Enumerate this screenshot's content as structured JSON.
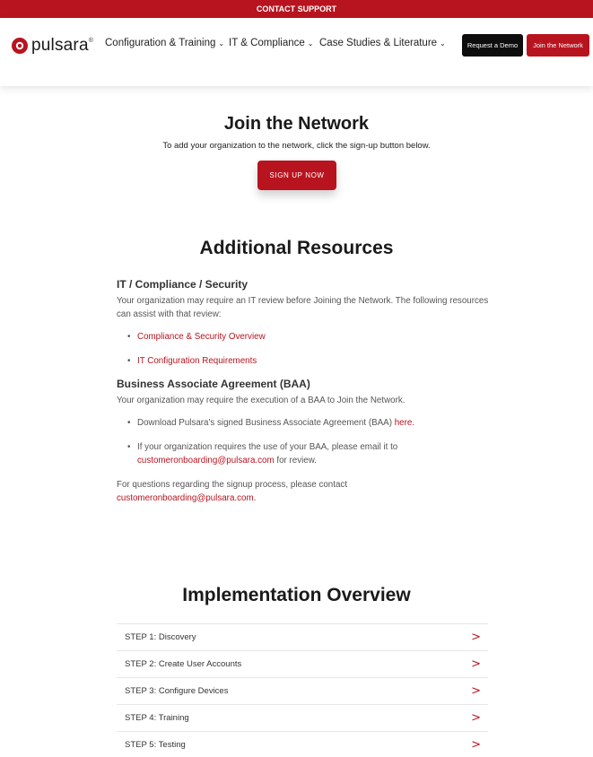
{
  "top_bar": {
    "label": "CONTACT SUPPORT"
  },
  "brand": {
    "name": "pulsara",
    "registered": "®",
    "accent_color": "#b8141f"
  },
  "nav": {
    "items": [
      {
        "label": "Configuration & Training"
      },
      {
        "label": "IT & Compliance"
      },
      {
        "label": "Case Studies & Literature"
      }
    ],
    "request_demo_label": "Request a Demo",
    "join_network_label": "Join the Network"
  },
  "join": {
    "title": "Join the Network",
    "text": "To add your organization to the network, click the sign-up button below.",
    "button_label": "SIGN UP NOW"
  },
  "resources": {
    "title": "Additional Resources",
    "it_heading": "IT / Compliance / Security",
    "it_text": "Your organization may require an IT review before Joining the Network. The following resources can assist with that review:",
    "it_links": [
      "Compliance & Security Overview",
      "IT Configuration Requirements"
    ],
    "baa_heading": "Business Associate Agreement (BAA)",
    "baa_text": "Your organization may require the execution of a BAA to Join the Network.",
    "baa_item1_text": "Download Pulsara's signed Business Associate Agreement (BAA) ",
    "baa_item1_link": "here.",
    "baa_item2_text": "If your organization requires the use of your BAA, please email it to ",
    "baa_item2_link": "customeronboarding@pulsara.com",
    "baa_item2_suffix": " for review.",
    "contact_text": "For questions regarding the signup process, please contact",
    "contact_link": "customeronboarding@pulsara.com."
  },
  "implementation": {
    "title": "Implementation Overview",
    "steps": [
      {
        "label": "STEP 1: Discovery"
      },
      {
        "label": "STEP 2: Create User Accounts"
      },
      {
        "label": "STEP 3: Configure Devices"
      },
      {
        "label": "STEP 4: Training"
      },
      {
        "label": "STEP 5: Testing"
      }
    ]
  },
  "icons": {
    "logo": "pulsara-logo-icon",
    "nav_dropdown": "chevron-down-icon",
    "step_expand": "chevron-right-icon"
  }
}
